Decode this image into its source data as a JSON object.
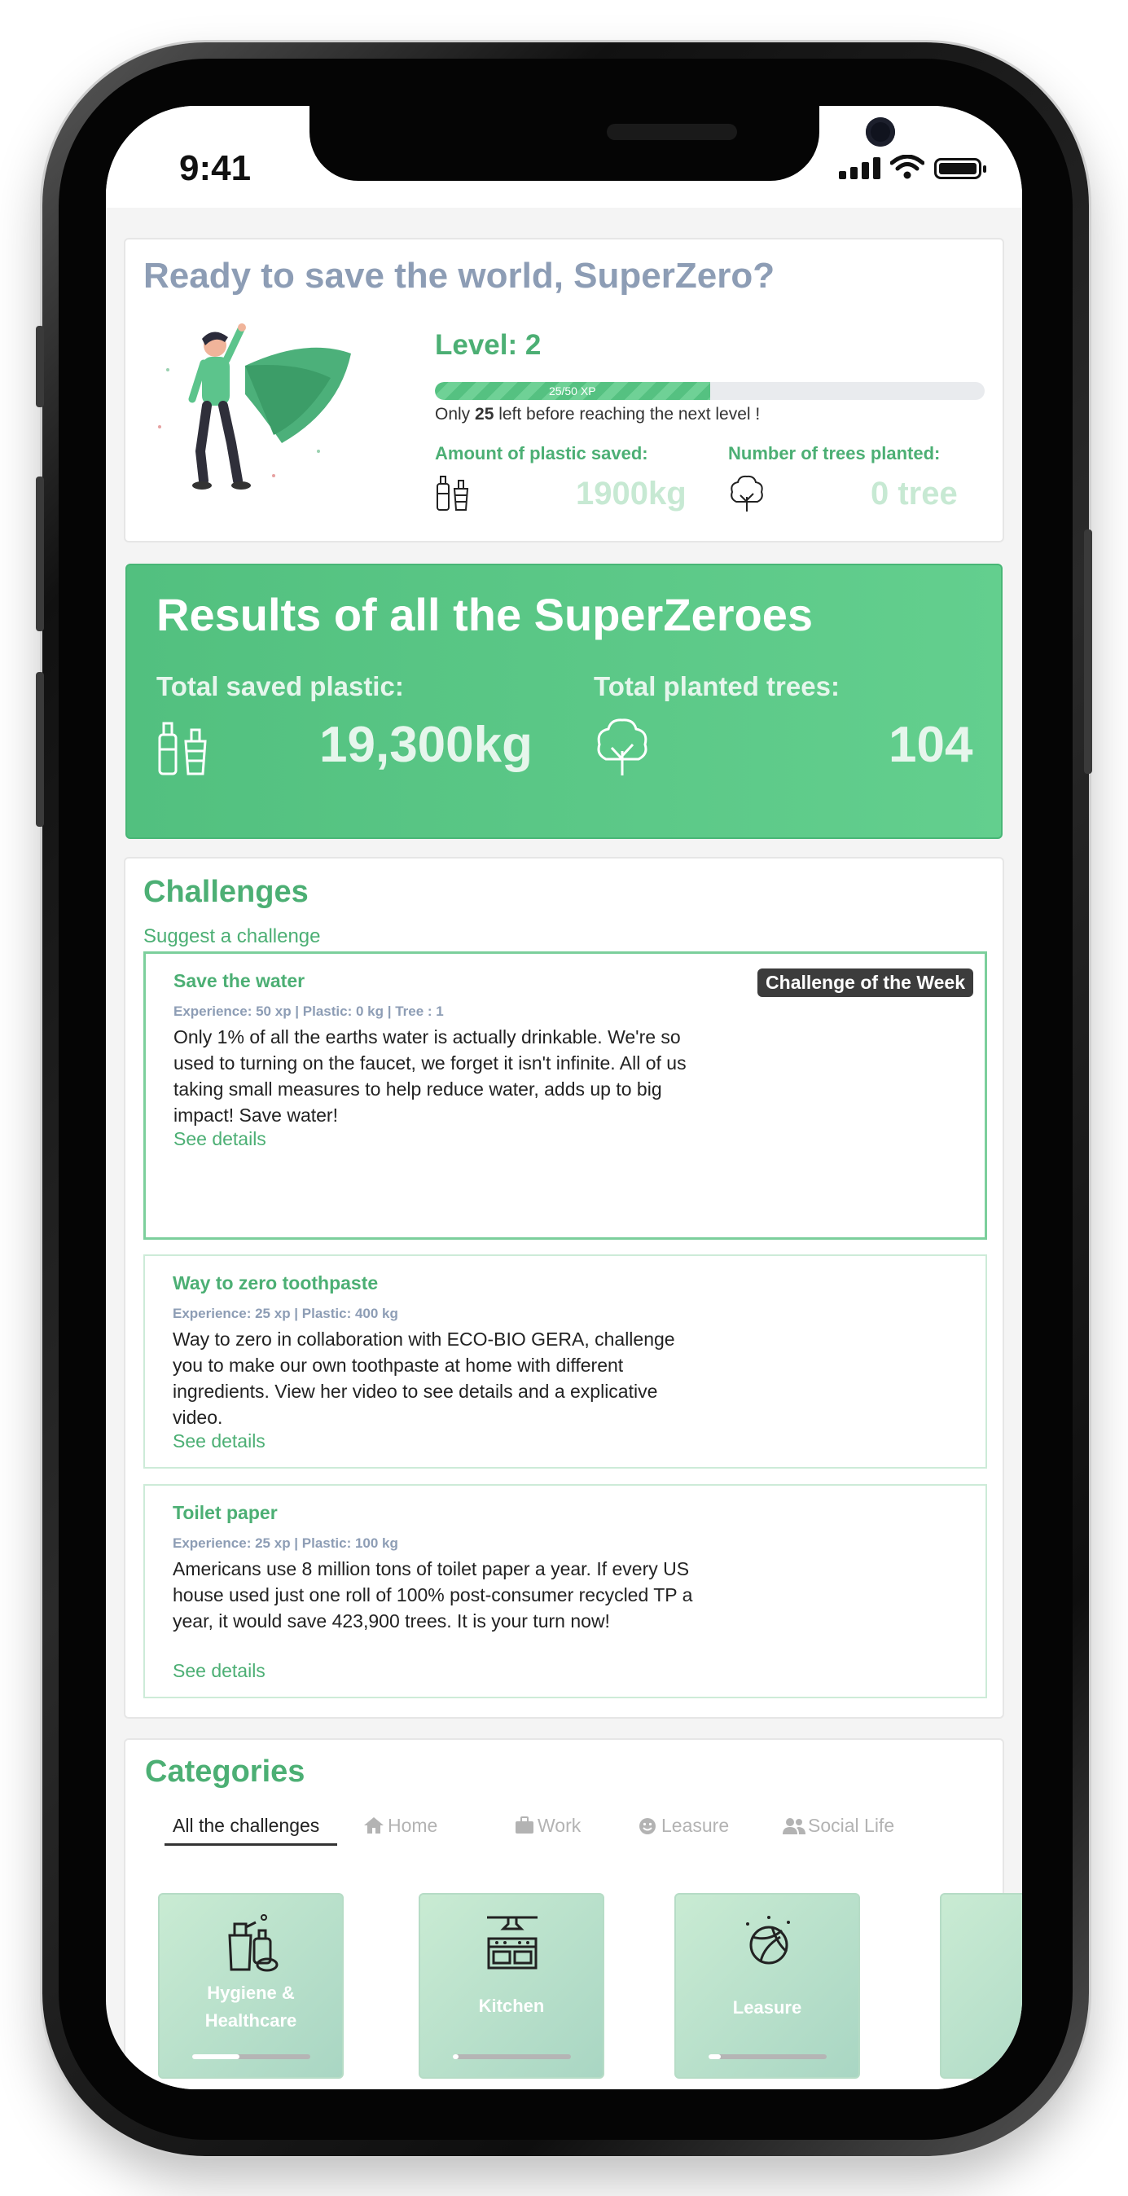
{
  "status": {
    "time": "9:41"
  },
  "profile": {
    "greeting": "Ready to save the world, SuperZero?",
    "level": "Level: 2",
    "xp_label": "25/50 XP",
    "xp_progress": 0.5,
    "note_prefix": "Only ",
    "note_value": "25",
    "note_suffix": " left before reaching the next level !",
    "plastic_label": "Amount of plastic saved:",
    "plastic_value": "1900kg",
    "trees_label": "Number of trees planted:",
    "trees_value": "0 tree"
  },
  "results": {
    "title": "Results of all the SuperZeroes",
    "plastic_label": "Total saved plastic:",
    "plastic_value": "19,300kg",
    "trees_label": "Total planted trees:",
    "trees_value": "104"
  },
  "challenges": {
    "title": "Challenges",
    "suggest": "Suggest a challenge",
    "items": [
      {
        "title": "Save the water",
        "meta": "Experience: 50 xp | Plastic: 0 kg | Tree : 1",
        "desc": "Only 1% of all the earths water is actually drinkable. We're so used to turning on the faucet, we forget it isn't infinite. All of us taking small measures to help reduce water, adds up to big impact! Save water!",
        "link": "See details",
        "badge": "Challenge of the Week"
      },
      {
        "title": "Way to zero toothpaste",
        "meta": "Experience: 25 xp | Plastic: 400 kg",
        "desc": "Way to zero in collaboration with ECO-BIO GERA, challenge you to make our own toothpaste at home with different ingredients. View her video to see details and a explicative video.",
        "link": "See details"
      },
      {
        "title": "Toilet paper",
        "meta": "Experience: 25 xp | Plastic: 100 kg",
        "desc": "Americans use 8 million tons of toilet paper a year. If every US house used just one roll of 100% post-consumer recycled TP a year, it would save 423,900 trees. It is your turn now!",
        "link": "See details"
      }
    ]
  },
  "categories": {
    "title": "Categories",
    "tabs": [
      "All the challenges",
      "Home",
      "Work",
      "Leasure",
      "Social Life"
    ],
    "cards": [
      {
        "label_line1": "Hygiene &",
        "label_line2": "Healthcare",
        "progress": 0.4
      },
      {
        "label": "Kitchen",
        "progress": 0.05
      },
      {
        "label": "Leasure",
        "progress": 0.1
      }
    ]
  },
  "colors": {
    "accent": "#4caf74",
    "muted": "#8d9db5",
    "badge": "#3c3c3c"
  },
  "icons": [
    "bottles-icon",
    "tree-icon",
    "home-icon",
    "briefcase-icon",
    "smile-icon",
    "users-icon",
    "superhero-illustration",
    "cleaning-products-icon",
    "kitchen-icon",
    "ball-icon"
  ]
}
